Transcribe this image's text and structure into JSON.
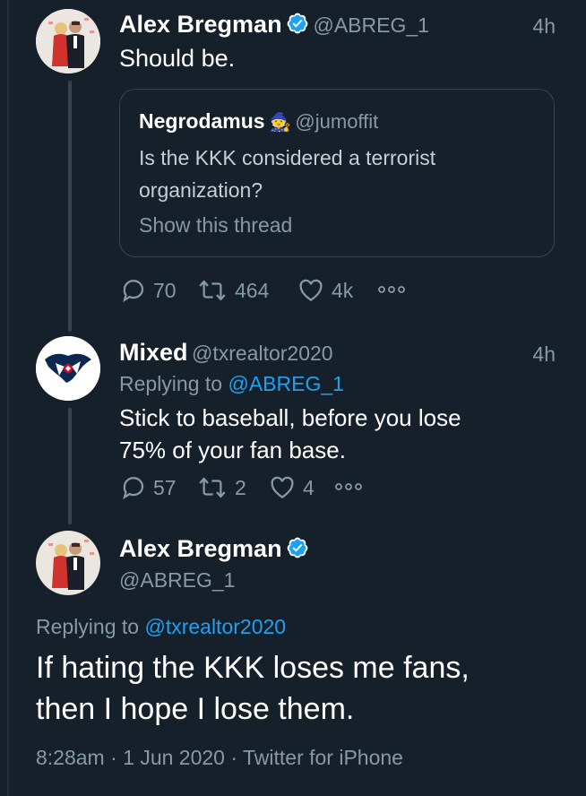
{
  "tweet1": {
    "name": "Alex Bregman",
    "handle": "@ABREG_1",
    "time": "4h",
    "text": "Should be.",
    "quote": {
      "name": "Negrodamus",
      "emoji": "🧙",
      "handle": "@jumoffit",
      "text_line1": "Is the KKK considered a terrorist",
      "text_line2": "organization?",
      "show_thread": "Show this thread"
    },
    "replies": "70",
    "retweets": "464",
    "likes": "4k"
  },
  "tweet2": {
    "name": "Mixed",
    "handle": "@txrealtor2020",
    "time": "4h",
    "replying_to_label": "Replying to",
    "replying_to_handle": "@ABREG_1",
    "text_line1": "Stick to baseball, before you lose",
    "text_line2": "75% of your fan base.",
    "replies": "57",
    "retweets": "2",
    "likes": "4"
  },
  "tweet3": {
    "name": "Alex Bregman",
    "handle": "@ABREG_1",
    "replying_to_label": "Replying to",
    "replying_to_handle": "@txrealtor2020",
    "text_line1": "If hating the KKK loses me fans,",
    "text_line2": "then I hope I lose them.",
    "meta": "8:28am · 1 Jun 2020 · Twitter for iPhone"
  },
  "colors": {
    "background": "#15202b",
    "accent": "#1da1f2",
    "muted": "#8899a6"
  }
}
